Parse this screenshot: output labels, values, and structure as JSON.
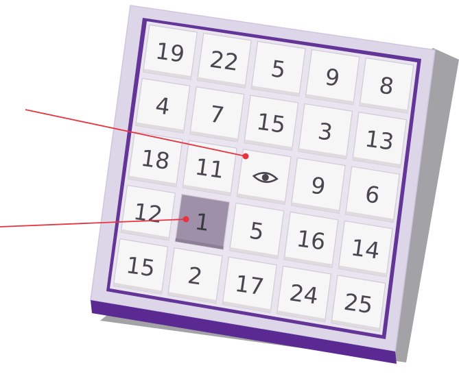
{
  "board": {
    "rows": [
      [
        {
          "label": "19"
        },
        {
          "label": "22"
        },
        {
          "label": "5"
        },
        {
          "label": "9"
        },
        {
          "label": "8"
        }
      ],
      [
        {
          "label": "4"
        },
        {
          "label": "7"
        },
        {
          "label": "15"
        },
        {
          "label": "3"
        },
        {
          "label": "13"
        }
      ],
      [
        {
          "label": "18"
        },
        {
          "label": "11"
        },
        {
          "label": "",
          "icon": "eye-icon"
        },
        {
          "label": "9"
        },
        {
          "label": "6"
        }
      ],
      [
        {
          "label": "12"
        },
        {
          "label": "1",
          "selected": true
        },
        {
          "label": "5"
        },
        {
          "label": "16"
        },
        {
          "label": "14"
        }
      ],
      [
        {
          "label": "15"
        },
        {
          "label": "2"
        },
        {
          "label": "17"
        },
        {
          "label": "24"
        },
        {
          "label": "25"
        }
      ]
    ],
    "selected_value": 1
  },
  "pointers": [
    {
      "name": "pointer-to-eye-tile"
    },
    {
      "name": "pointer-to-selected-tile"
    }
  ],
  "colors": {
    "frame_outer": "#ddd6e9",
    "frame_inner": "#623596",
    "frame_shadow": "#a3a3a7",
    "frame_base": "#5a2a92",
    "tile": "#f6f6f6",
    "tile_selected": "#9f90aa",
    "tile_text": "#4a4650",
    "pointer": "#e8323f"
  }
}
